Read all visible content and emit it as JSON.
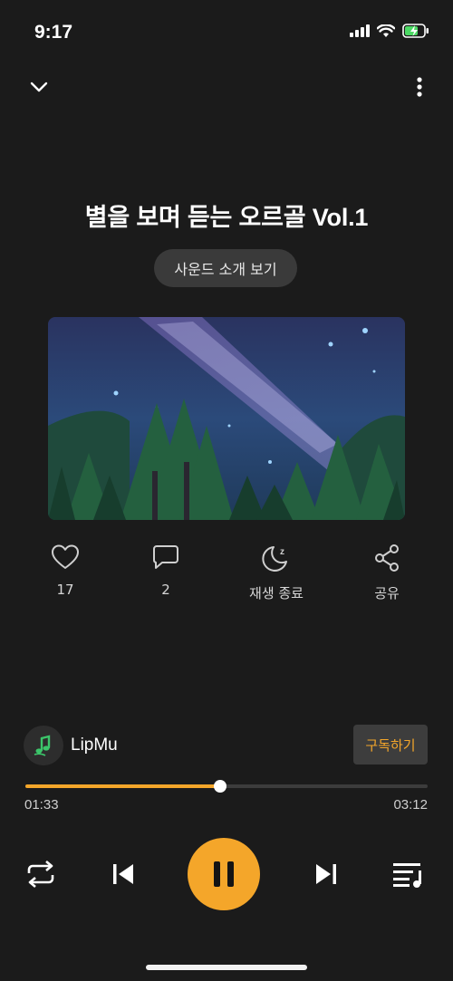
{
  "status_bar": {
    "time": "9:17"
  },
  "player": {
    "title": "별을 보며 듣는 오르골 Vol.1",
    "intro_button": "사운드 소개 보기",
    "actions": {
      "like_count": "17",
      "comment_count": "2",
      "sleep_timer": "재생 종료",
      "share": "공유"
    },
    "artist": {
      "name": "LipMu",
      "subscribe": "구독하기"
    },
    "progress": {
      "elapsed": "01:33",
      "total": "03:12",
      "fraction": 0.484
    }
  },
  "colors": {
    "accent": "#f4a62a",
    "background": "#1b1b1b",
    "button_bg": "#3a3a3a"
  },
  "icons": [
    "chevron-down-icon",
    "more-vertical-icon",
    "heart-icon",
    "comment-icon",
    "moon-icon",
    "share-icon",
    "repeat-icon",
    "skip-previous-icon",
    "pause-icon",
    "skip-next-icon",
    "playlist-icon"
  ]
}
